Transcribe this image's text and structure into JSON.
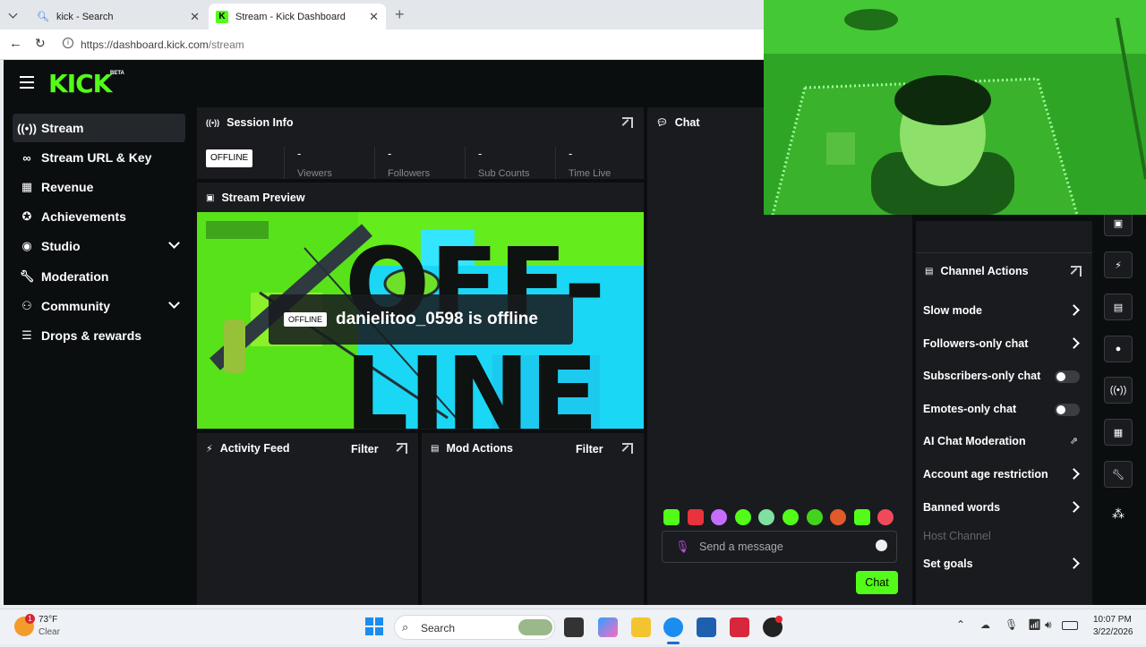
{
  "browser": {
    "tabs": [
      {
        "title": "kick - Search"
      },
      {
        "title": "Stream - Kick Dashboard"
      }
    ],
    "url_host": "https://dashboard.kick.com",
    "url_path": "/stream"
  },
  "brand": {
    "logo": "KICK",
    "badge": "BETA",
    "accent": "#53fc18"
  },
  "sidebar": {
    "items": [
      {
        "label": "Stream"
      },
      {
        "label": "Stream URL & Key"
      },
      {
        "label": "Revenue"
      },
      {
        "label": "Achievements"
      },
      {
        "label": "Studio"
      },
      {
        "label": "Moderation"
      },
      {
        "label": "Community"
      },
      {
        "label": "Drops & rewards"
      }
    ]
  },
  "session": {
    "title": "Session Info",
    "status": "OFFLINE",
    "stats": [
      {
        "value": "-",
        "label": "Viewers"
      },
      {
        "value": "-",
        "label": "Followers"
      },
      {
        "value": "-",
        "label": "Sub Counts"
      },
      {
        "value": "-",
        "label": "Time Live"
      }
    ]
  },
  "preview": {
    "title": "Stream Preview",
    "badge": "OFFLINE",
    "message": "danielitoo_0598 is offline",
    "art_text_1": "OFF-",
    "art_text_2": "LINE"
  },
  "activity": {
    "title": "Activity Feed",
    "filter": "Filter"
  },
  "mod": {
    "title": "Mod Actions",
    "filter": "Filter"
  },
  "chat": {
    "title": "Chat",
    "placeholder": "Send a message",
    "send": "Chat"
  },
  "channel_actions": {
    "title": "Channel Actions",
    "items": [
      {
        "label": "Slow mode"
      },
      {
        "label": "Followers-only chat"
      },
      {
        "label": "Subscribers-only chat"
      },
      {
        "label": "Emotes-only chat"
      },
      {
        "label": "AI Chat Moderation"
      },
      {
        "label": "Account age restriction"
      },
      {
        "label": "Banned words"
      },
      {
        "label": "Host Channel"
      },
      {
        "label": "Set goals"
      }
    ]
  },
  "taskbar": {
    "temp": "73°F",
    "weather": "Clear",
    "weather_badge": "1",
    "search": "Search",
    "time": "10:07 PM",
    "date": "3/22/2026"
  }
}
